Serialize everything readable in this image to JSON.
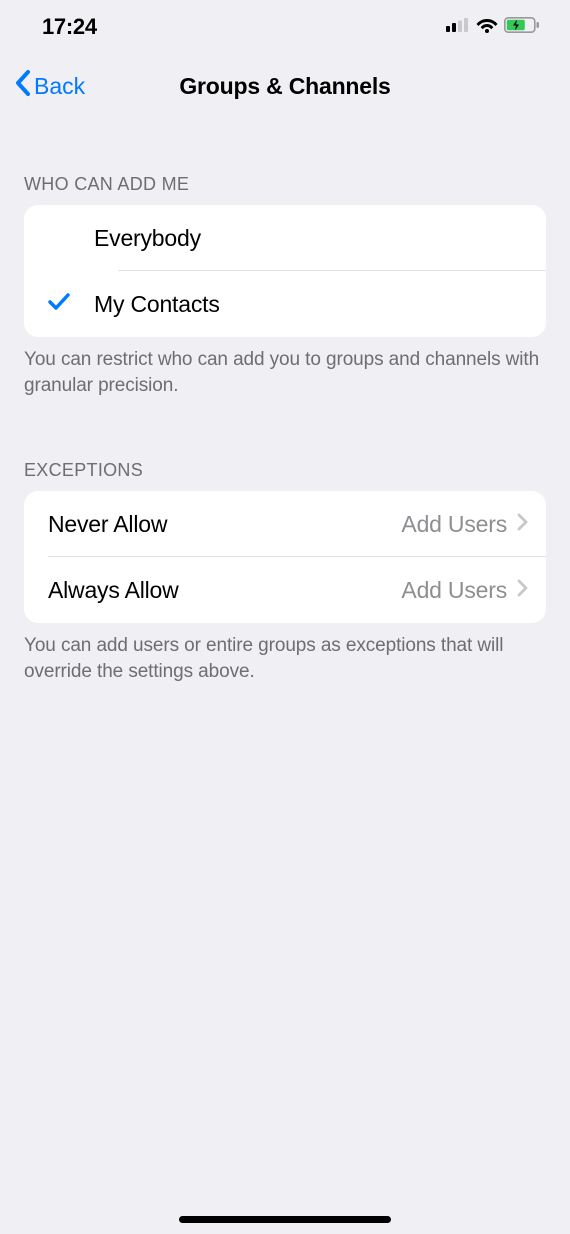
{
  "status": {
    "time": "17:24"
  },
  "nav": {
    "back": "Back",
    "title": "Groups & Channels"
  },
  "sections": {
    "whoCanAdd": {
      "header": "WHO CAN ADD ME",
      "options": {
        "everybody": "Everybody",
        "myContacts": "My Contacts"
      },
      "footer": "You can restrict who can add you to groups and channels with granular precision."
    },
    "exceptions": {
      "header": "EXCEPTIONS",
      "rows": {
        "neverAllow": {
          "label": "Never Allow",
          "detail": "Add Users"
        },
        "alwaysAllow": {
          "label": "Always Allow",
          "detail": "Add Users"
        }
      },
      "footer": "You can add users or entire groups as exceptions that will override the settings above."
    }
  }
}
